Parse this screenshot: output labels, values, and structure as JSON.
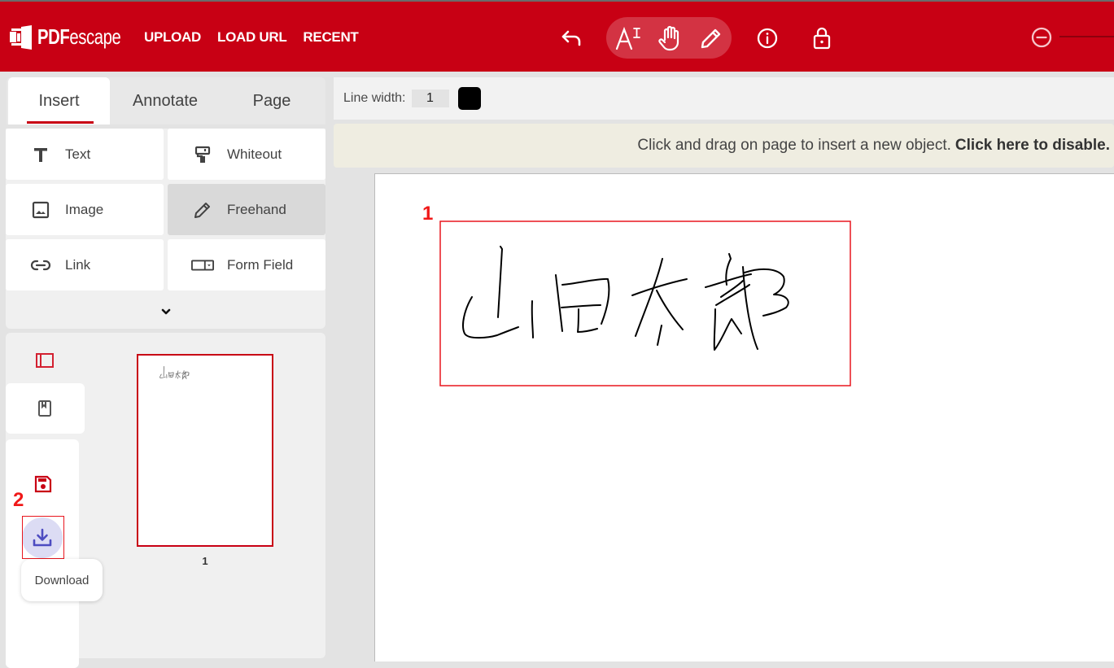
{
  "app": {
    "logo": {
      "prefix": "PDF",
      "suffix": "escape"
    },
    "nav": [
      "UPLOAD",
      "LOAD URL",
      "RECENT"
    ],
    "toolbar_icons": [
      "undo-icon",
      "text-select-icon",
      "hand-pan-icon",
      "pencil-icon",
      "info-icon",
      "lock-icon",
      "zoom-out-icon"
    ],
    "brand_color": "#c80014"
  },
  "left_panel": {
    "tabs": [
      {
        "label": "Insert",
        "active": true
      },
      {
        "label": "Annotate",
        "active": false
      },
      {
        "label": "Page",
        "active": false
      }
    ],
    "tools": [
      {
        "label": "Text",
        "icon": "text-icon",
        "selected": false
      },
      {
        "label": "Whiteout",
        "icon": "paint-roller-icon",
        "selected": false
      },
      {
        "label": "Image",
        "icon": "image-icon",
        "selected": false
      },
      {
        "label": "Freehand",
        "icon": "pencil-icon",
        "selected": true
      },
      {
        "label": "Link",
        "icon": "link-icon",
        "selected": false
      },
      {
        "label": "Form Field",
        "icon": "form-field-icon",
        "selected": false
      }
    ],
    "expand_icon": "chevron-down-icon",
    "pages": {
      "thumbnails": [
        {
          "page_number": "1",
          "content_preview": "山田太郎"
        }
      ],
      "side_buttons": [
        "thumbnails-icon",
        "bookmark-icon",
        "save-icon",
        "download-icon"
      ],
      "tooltip": "Download"
    }
  },
  "options_bar": {
    "line_width_label": "Line width:",
    "line_width_value": "1",
    "color": "#000000"
  },
  "hint": {
    "text": "Click and drag on page to insert a new object.",
    "link": "Click here to disable."
  },
  "document": {
    "freehand_text": "山田太郎"
  },
  "annotations": [
    {
      "number": "1",
      "target": "freehand-signature"
    },
    {
      "number": "2",
      "target": "download-button"
    }
  ]
}
